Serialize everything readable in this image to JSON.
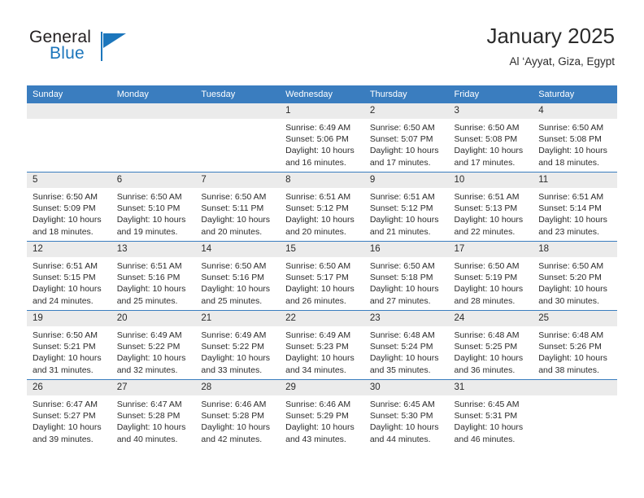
{
  "brand": {
    "word1": "General",
    "word2": "Blue",
    "logo_icon": "triangle-flag-icon",
    "primary_color": "#1c76bc"
  },
  "header": {
    "title": "January 2025",
    "subtitle": "Al ‘Ayyat, Giza, Egypt"
  },
  "calendar": {
    "header_color": "#3a7dbf",
    "daynum_bg": "#ebebeb",
    "weekday_headers": [
      "Sunday",
      "Monday",
      "Tuesday",
      "Wednesday",
      "Thursday",
      "Friday",
      "Saturday"
    ],
    "weeks": [
      [
        {
          "day": "",
          "empty": true,
          "sunrise": "",
          "sunset": "",
          "daylight1": "",
          "daylight2": ""
        },
        {
          "day": "",
          "empty": true,
          "sunrise": "",
          "sunset": "",
          "daylight1": "",
          "daylight2": ""
        },
        {
          "day": "",
          "empty": true,
          "sunrise": "",
          "sunset": "",
          "daylight1": "",
          "daylight2": ""
        },
        {
          "day": "1",
          "empty": false,
          "sunrise": "Sunrise: 6:49 AM",
          "sunset": "Sunset: 5:06 PM",
          "daylight1": "Daylight: 10 hours",
          "daylight2": "and 16 minutes."
        },
        {
          "day": "2",
          "empty": false,
          "sunrise": "Sunrise: 6:50 AM",
          "sunset": "Sunset: 5:07 PM",
          "daylight1": "Daylight: 10 hours",
          "daylight2": "and 17 minutes."
        },
        {
          "day": "3",
          "empty": false,
          "sunrise": "Sunrise: 6:50 AM",
          "sunset": "Sunset: 5:08 PM",
          "daylight1": "Daylight: 10 hours",
          "daylight2": "and 17 minutes."
        },
        {
          "day": "4",
          "empty": false,
          "sunrise": "Sunrise: 6:50 AM",
          "sunset": "Sunset: 5:08 PM",
          "daylight1": "Daylight: 10 hours",
          "daylight2": "and 18 minutes."
        }
      ],
      [
        {
          "day": "5",
          "empty": false,
          "sunrise": "Sunrise: 6:50 AM",
          "sunset": "Sunset: 5:09 PM",
          "daylight1": "Daylight: 10 hours",
          "daylight2": "and 18 minutes."
        },
        {
          "day": "6",
          "empty": false,
          "sunrise": "Sunrise: 6:50 AM",
          "sunset": "Sunset: 5:10 PM",
          "daylight1": "Daylight: 10 hours",
          "daylight2": "and 19 minutes."
        },
        {
          "day": "7",
          "empty": false,
          "sunrise": "Sunrise: 6:50 AM",
          "sunset": "Sunset: 5:11 PM",
          "daylight1": "Daylight: 10 hours",
          "daylight2": "and 20 minutes."
        },
        {
          "day": "8",
          "empty": false,
          "sunrise": "Sunrise: 6:51 AM",
          "sunset": "Sunset: 5:12 PM",
          "daylight1": "Daylight: 10 hours",
          "daylight2": "and 20 minutes."
        },
        {
          "day": "9",
          "empty": false,
          "sunrise": "Sunrise: 6:51 AM",
          "sunset": "Sunset: 5:12 PM",
          "daylight1": "Daylight: 10 hours",
          "daylight2": "and 21 minutes."
        },
        {
          "day": "10",
          "empty": false,
          "sunrise": "Sunrise: 6:51 AM",
          "sunset": "Sunset: 5:13 PM",
          "daylight1": "Daylight: 10 hours",
          "daylight2": "and 22 minutes."
        },
        {
          "day": "11",
          "empty": false,
          "sunrise": "Sunrise: 6:51 AM",
          "sunset": "Sunset: 5:14 PM",
          "daylight1": "Daylight: 10 hours",
          "daylight2": "and 23 minutes."
        }
      ],
      [
        {
          "day": "12",
          "empty": false,
          "sunrise": "Sunrise: 6:51 AM",
          "sunset": "Sunset: 5:15 PM",
          "daylight1": "Daylight: 10 hours",
          "daylight2": "and 24 minutes."
        },
        {
          "day": "13",
          "empty": false,
          "sunrise": "Sunrise: 6:51 AM",
          "sunset": "Sunset: 5:16 PM",
          "daylight1": "Daylight: 10 hours",
          "daylight2": "and 25 minutes."
        },
        {
          "day": "14",
          "empty": false,
          "sunrise": "Sunrise: 6:50 AM",
          "sunset": "Sunset: 5:16 PM",
          "daylight1": "Daylight: 10 hours",
          "daylight2": "and 25 minutes."
        },
        {
          "day": "15",
          "empty": false,
          "sunrise": "Sunrise: 6:50 AM",
          "sunset": "Sunset: 5:17 PM",
          "daylight1": "Daylight: 10 hours",
          "daylight2": "and 26 minutes."
        },
        {
          "day": "16",
          "empty": false,
          "sunrise": "Sunrise: 6:50 AM",
          "sunset": "Sunset: 5:18 PM",
          "daylight1": "Daylight: 10 hours",
          "daylight2": "and 27 minutes."
        },
        {
          "day": "17",
          "empty": false,
          "sunrise": "Sunrise: 6:50 AM",
          "sunset": "Sunset: 5:19 PM",
          "daylight1": "Daylight: 10 hours",
          "daylight2": "and 28 minutes."
        },
        {
          "day": "18",
          "empty": false,
          "sunrise": "Sunrise: 6:50 AM",
          "sunset": "Sunset: 5:20 PM",
          "daylight1": "Daylight: 10 hours",
          "daylight2": "and 30 minutes."
        }
      ],
      [
        {
          "day": "19",
          "empty": false,
          "sunrise": "Sunrise: 6:50 AM",
          "sunset": "Sunset: 5:21 PM",
          "daylight1": "Daylight: 10 hours",
          "daylight2": "and 31 minutes."
        },
        {
          "day": "20",
          "empty": false,
          "sunrise": "Sunrise: 6:49 AM",
          "sunset": "Sunset: 5:22 PM",
          "daylight1": "Daylight: 10 hours",
          "daylight2": "and 32 minutes."
        },
        {
          "day": "21",
          "empty": false,
          "sunrise": "Sunrise: 6:49 AM",
          "sunset": "Sunset: 5:22 PM",
          "daylight1": "Daylight: 10 hours",
          "daylight2": "and 33 minutes."
        },
        {
          "day": "22",
          "empty": false,
          "sunrise": "Sunrise: 6:49 AM",
          "sunset": "Sunset: 5:23 PM",
          "daylight1": "Daylight: 10 hours",
          "daylight2": "and 34 minutes."
        },
        {
          "day": "23",
          "empty": false,
          "sunrise": "Sunrise: 6:48 AM",
          "sunset": "Sunset: 5:24 PM",
          "daylight1": "Daylight: 10 hours",
          "daylight2": "and 35 minutes."
        },
        {
          "day": "24",
          "empty": false,
          "sunrise": "Sunrise: 6:48 AM",
          "sunset": "Sunset: 5:25 PM",
          "daylight1": "Daylight: 10 hours",
          "daylight2": "and 36 minutes."
        },
        {
          "day": "25",
          "empty": false,
          "sunrise": "Sunrise: 6:48 AM",
          "sunset": "Sunset: 5:26 PM",
          "daylight1": "Daylight: 10 hours",
          "daylight2": "and 38 minutes."
        }
      ],
      [
        {
          "day": "26",
          "empty": false,
          "sunrise": "Sunrise: 6:47 AM",
          "sunset": "Sunset: 5:27 PM",
          "daylight1": "Daylight: 10 hours",
          "daylight2": "and 39 minutes."
        },
        {
          "day": "27",
          "empty": false,
          "sunrise": "Sunrise: 6:47 AM",
          "sunset": "Sunset: 5:28 PM",
          "daylight1": "Daylight: 10 hours",
          "daylight2": "and 40 minutes."
        },
        {
          "day": "28",
          "empty": false,
          "sunrise": "Sunrise: 6:46 AM",
          "sunset": "Sunset: 5:28 PM",
          "daylight1": "Daylight: 10 hours",
          "daylight2": "and 42 minutes."
        },
        {
          "day": "29",
          "empty": false,
          "sunrise": "Sunrise: 6:46 AM",
          "sunset": "Sunset: 5:29 PM",
          "daylight1": "Daylight: 10 hours",
          "daylight2": "and 43 minutes."
        },
        {
          "day": "30",
          "empty": false,
          "sunrise": "Sunrise: 6:45 AM",
          "sunset": "Sunset: 5:30 PM",
          "daylight1": "Daylight: 10 hours",
          "daylight2": "and 44 minutes."
        },
        {
          "day": "31",
          "empty": false,
          "sunrise": "Sunrise: 6:45 AM",
          "sunset": "Sunset: 5:31 PM",
          "daylight1": "Daylight: 10 hours",
          "daylight2": "and 46 minutes."
        },
        {
          "day": "",
          "empty": true,
          "sunrise": "",
          "sunset": "",
          "daylight1": "",
          "daylight2": ""
        }
      ]
    ]
  }
}
